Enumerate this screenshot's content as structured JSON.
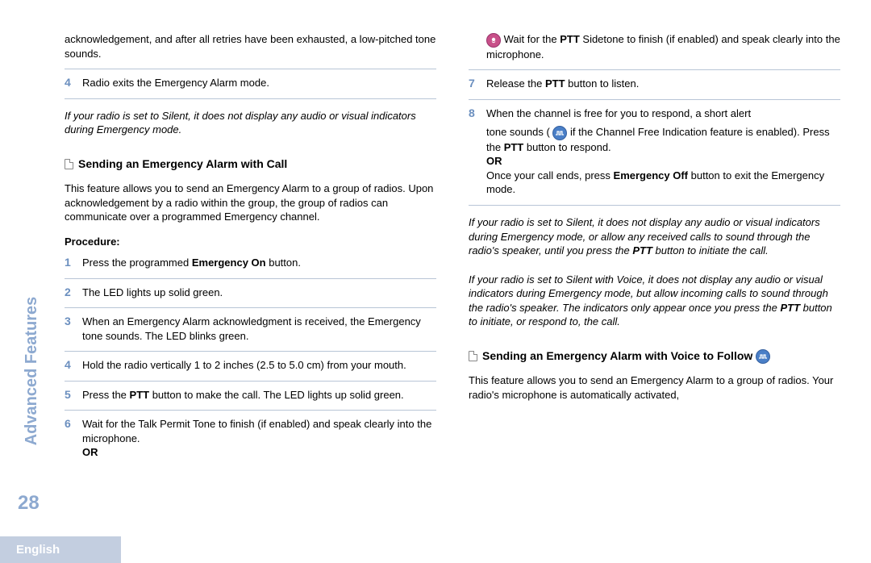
{
  "sideTitle": "Advanced Features",
  "pageNumber": "28",
  "language": "English",
  "leftCol": {
    "continuedText": "acknowledgement, and after all retries have been exhausted, a low-pitched tone sounds.",
    "step4": {
      "num": "4",
      "text": "Radio exits the Emergency Alarm mode."
    },
    "silentNote": "If your radio is set to Silent, it does not display any audio or visual indicators during Emergency mode.",
    "sectionTitle": "Sending an Emergency Alarm with Call",
    "intro": "This feature allows you to send an Emergency Alarm to a group of radios. Upon acknowledgement by a radio within the group, the group of radios can communicate over a programmed Emergency channel.",
    "procedureLabel": "Procedure:",
    "steps": {
      "s1": {
        "num": "1",
        "pre": "Press the programmed ",
        "bold": "Emergency On",
        "post": " button."
      },
      "s2": {
        "num": "2",
        "text": "The LED lights up solid green."
      },
      "s3": {
        "num": "3",
        "text": "When an Emergency Alarm acknowledgment is received, the Emergency tone sounds. The LED blinks green."
      },
      "s4": {
        "num": "4",
        "text": "Hold the radio vertically 1 to 2 inches (2.5 to 5.0 cm) from your mouth."
      },
      "s5": {
        "num": "5",
        "pre": "Press the ",
        "bold": "PTT",
        "post": " button to make the call. The LED lights up solid green."
      },
      "s6": {
        "num": "6",
        "text": "Wait for the Talk Permit Tone to finish (if enabled) and speak clearly into the microphone.",
        "or": "OR"
      }
    }
  },
  "rightCol": {
    "iconLine": {
      "pre": " Wait for the ",
      "bold": "PTT",
      "post": " Sidetone to finish (if enabled) and speak clearly into the microphone."
    },
    "step7": {
      "num": "7",
      "pre": "Release the ",
      "bold": "PTT",
      "post": " button to listen."
    },
    "step8": {
      "num": "8",
      "line1": "When the channel is free for you to respond, a short alert",
      "line2pre": "tone sounds ( ",
      "line2mid": " if the Channel Free Indication feature is enabled). Press the ",
      "line2bold": "PTT",
      "line2post": " button to respond.",
      "or": "OR",
      "line3pre": "Once your call ends, press ",
      "line3bold": "Emergency Off",
      "line3post": " button to exit the Emergency mode."
    },
    "note1": {
      "pre": "If your radio is set to Silent, it does not display any audio or visual indicators during Emergency mode, or allow any received calls to sound through the radio's speaker, until you press the ",
      "bold": "PTT",
      "post": " button to initiate the call."
    },
    "note2": {
      "pre": "If your radio is set to Silent with Voice, it does not display any audio or visual indicators during Emergency mode, but allow incoming calls to sound through the radio's speaker. The indicators only appear once you press the ",
      "bold": "PTT",
      "post": " button to initiate, or respond to, the call."
    },
    "section2Title": "Sending an Emergency Alarm with Voice to Follow ",
    "section2Intro": "This feature allows you to send an Emergency Alarm to a group of radios. Your radio's microphone is automatically activated,"
  }
}
